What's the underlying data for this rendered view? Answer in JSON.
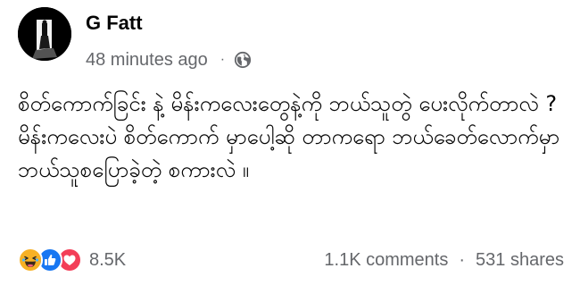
{
  "post": {
    "author": "G Fatt",
    "timestamp": "48 minutes ago",
    "separator": "·",
    "audience_icon": "globe-icon",
    "message": "စိတ်ကောက်ခြင်း နဲ့ မိန်းကလေးတွေနဲ့ကို ဘယ်သူတွဲ ပေးလိုက်တာလဲ ? မိန်းကလေးပဲ စိတ်ကောက် မှာပေါ့ဆို တာကရော ဘယ်ခေတ်လောက်မှာ ဘယ်သူစပြောခဲ့တဲ့ စကားလဲ ။"
  },
  "footer": {
    "reactions": [
      "haha-icon",
      "like-icon",
      "love-icon"
    ],
    "reaction_count": "8.5K",
    "comments": "1.1K comments",
    "separator": "·",
    "shares": "531 shares"
  },
  "colors": {
    "text_primary": "#050505",
    "text_secondary": "#65676b",
    "like_blue": "#1877f2",
    "love_red": "#f33e58",
    "haha_yellow": "#f7b125"
  }
}
